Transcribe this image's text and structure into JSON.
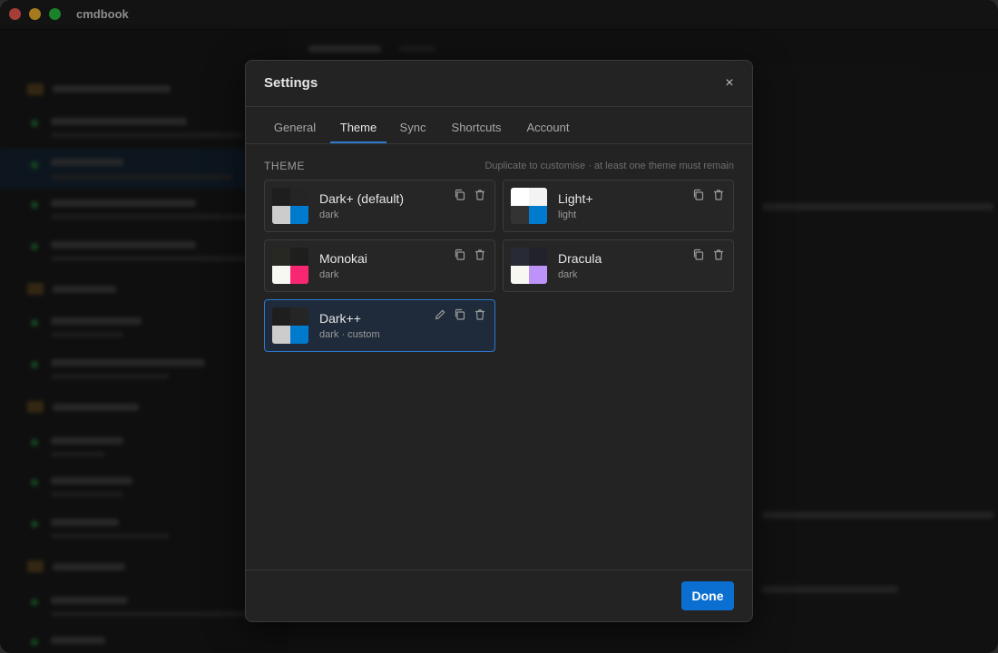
{
  "app": {
    "title": "cmdbook"
  },
  "modal": {
    "title": "Settings",
    "tabs": [
      {
        "label": "General"
      },
      {
        "label": "Theme"
      },
      {
        "label": "Sync"
      },
      {
        "label": "Shortcuts"
      },
      {
        "label": "Account"
      }
    ],
    "active_tab": "Theme",
    "section": {
      "label": "THEME",
      "hint": "Duplicate to customise · at least one theme must remain"
    },
    "themes": [
      {
        "name": "Dark+ (default)",
        "sub": "dark",
        "colors": [
          "#1e1e1e",
          "#252526",
          "#cccccc",
          "#007acc"
        ],
        "editable": false,
        "selected": false
      },
      {
        "name": "Light+",
        "sub": "light",
        "colors": [
          "#ffffff",
          "#f3f3f3",
          "#333333",
          "#007acc"
        ],
        "editable": false,
        "selected": false
      },
      {
        "name": "Monokai",
        "sub": "dark",
        "colors": [
          "#272822",
          "#1e1f1c",
          "#f8f8f2",
          "#f92672"
        ],
        "editable": false,
        "selected": false
      },
      {
        "name": "Dracula",
        "sub": "dark",
        "colors": [
          "#282a36",
          "#21222c",
          "#f8f8f2",
          "#bd93f9"
        ],
        "editable": false,
        "selected": false
      },
      {
        "name": "Dark++",
        "sub": "dark · custom",
        "colors": [
          "#1e1e1e",
          "#252526",
          "#cccccc",
          "#007acc"
        ],
        "editable": true,
        "selected": true
      }
    ],
    "footer": {
      "done_label": "Done"
    }
  },
  "icons": {
    "close": "close-icon",
    "copy": "copy-icon",
    "delete": "trash-icon",
    "edit": "pencil-icon"
  },
  "colors": {
    "accent": "#0a6fd0",
    "selected_border": "#2d7bd1"
  }
}
